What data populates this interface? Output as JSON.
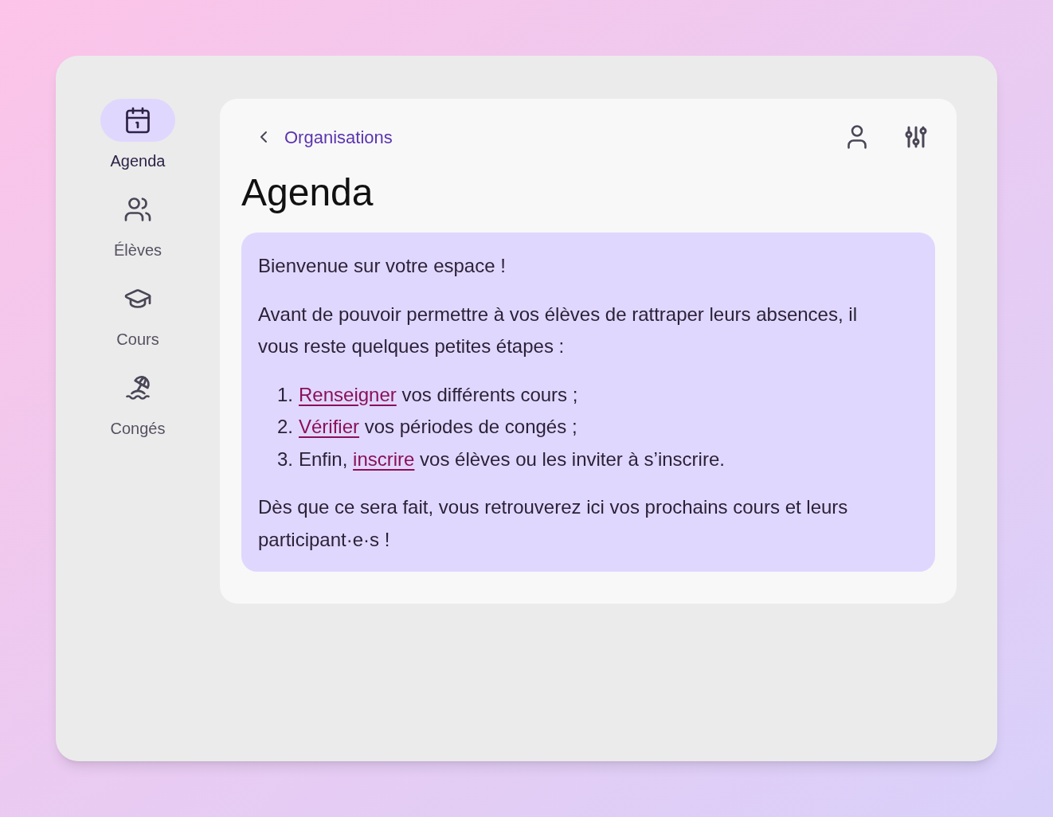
{
  "sidebar": {
    "items": [
      {
        "label": "Agenda",
        "selected": true
      },
      {
        "label": "Élèves",
        "selected": false
      },
      {
        "label": "Cours",
        "selected": false
      },
      {
        "label": "Congés",
        "selected": false
      }
    ]
  },
  "header": {
    "back_link": "Organisations"
  },
  "page_title": "Agenda",
  "notice": {
    "greeting": "Bienvenue sur votre espace !",
    "intro": "Avant de pouvoir permettre à vos élèves de rattraper leurs absences, il vous reste quelques petites étapes :",
    "steps": [
      {
        "number": "1.",
        "link": "Renseigner",
        "suffix": " vos différents cours ;"
      },
      {
        "number": "2.",
        "link": "Vérifier",
        "suffix": " vos périodes de congés ;"
      },
      {
        "number": "3.",
        "prefix": "Enfin, ",
        "link": "inscrire",
        "suffix": " vos élèves ou les inviter à s’inscrire."
      }
    ],
    "outro": "Dès que ce sera fait, vous retrouverez ici vos prochains cours et leurs participant·e·s !"
  }
}
